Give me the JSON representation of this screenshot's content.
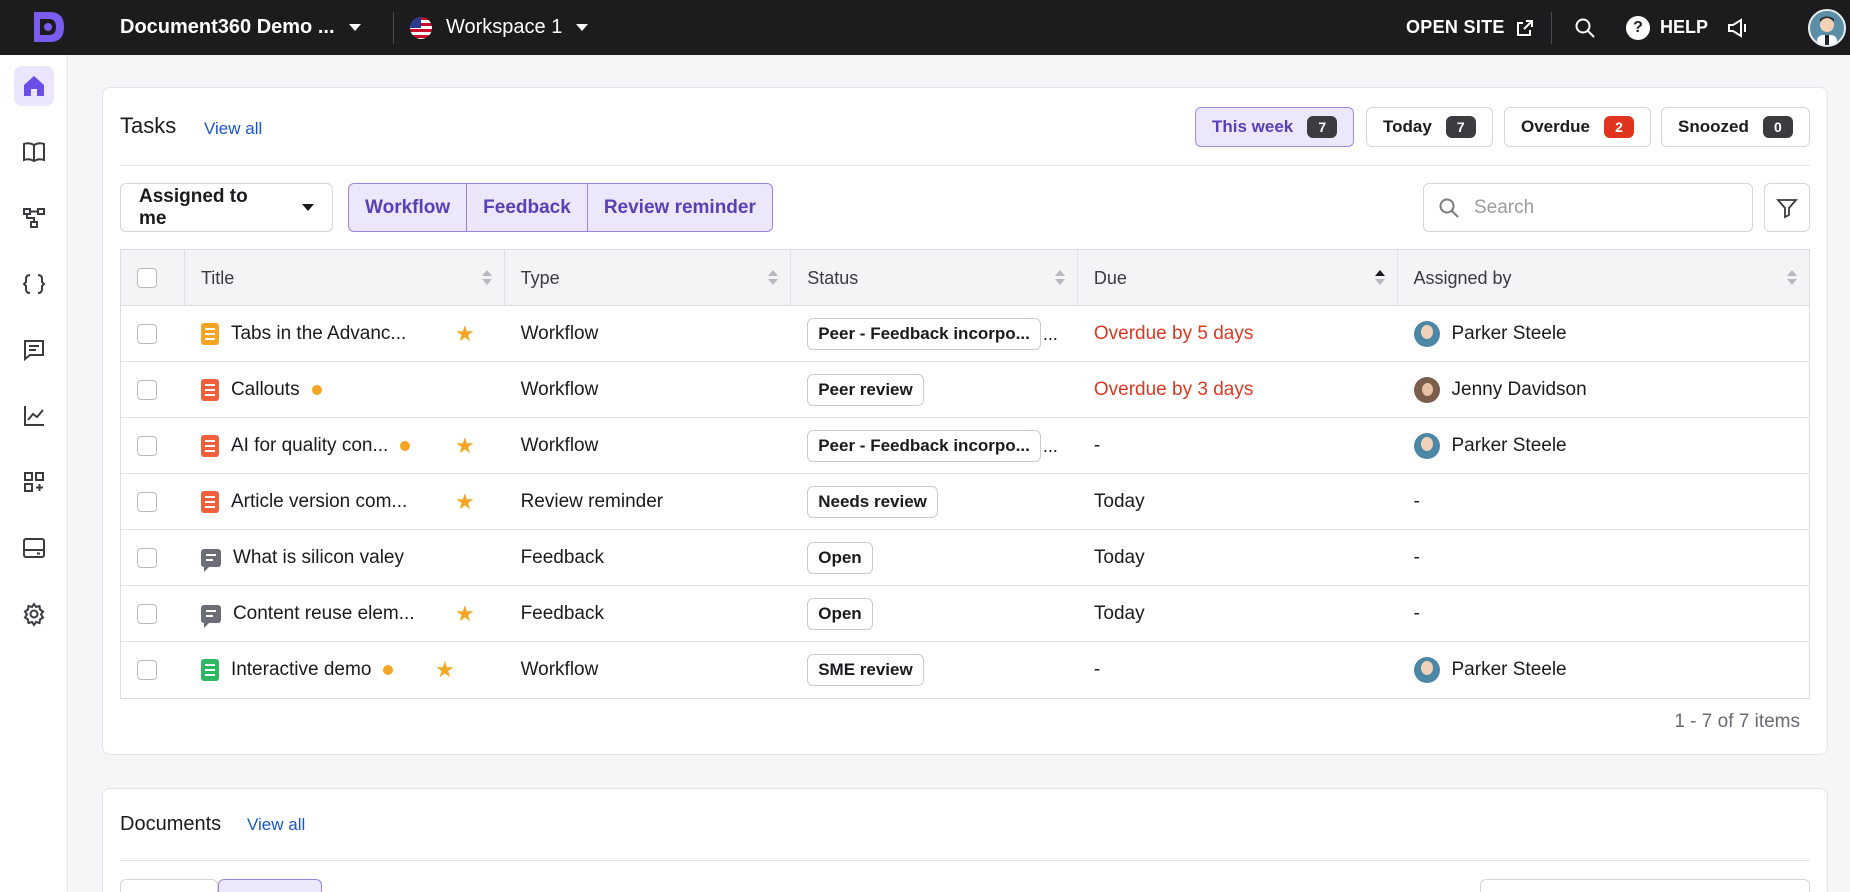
{
  "topbar": {
    "project_name": "Document360 Demo ...",
    "workspace_name": "Workspace 1",
    "open_site_label": "OPEN SITE",
    "help_label": "HELP"
  },
  "sidebar": {
    "items": [
      {
        "icon": "home-icon",
        "active": true
      },
      {
        "icon": "book-icon",
        "active": false
      },
      {
        "icon": "hierarchy-icon",
        "active": false
      },
      {
        "icon": "code-braces-icon",
        "active": false
      },
      {
        "icon": "comment-icon",
        "active": false
      },
      {
        "icon": "analytics-icon",
        "active": false
      },
      {
        "icon": "apps-icon",
        "active": false
      },
      {
        "icon": "widget-icon",
        "active": false
      },
      {
        "icon": "settings-icon",
        "active": false
      }
    ]
  },
  "tasks": {
    "title": "Tasks",
    "view_all": "View all",
    "time_filters": [
      {
        "label": "This week",
        "count": "7",
        "active": true
      },
      {
        "label": "Today",
        "count": "7",
        "active": false
      },
      {
        "label": "Overdue",
        "count": "2",
        "active": false
      },
      {
        "label": "Snoozed",
        "count": "0",
        "active": false
      }
    ],
    "assignment_dropdown": "Assigned to me",
    "type_filters": [
      "Workflow",
      "Feedback",
      "Review reminder"
    ],
    "search_placeholder": "Search",
    "columns": [
      "Title",
      "Type",
      "Status",
      "Due",
      "Assigned by"
    ],
    "rows": [
      {
        "title": "Tabs in the Advanc...",
        "icon_color": "#f5a524",
        "icon": "document-icon",
        "dot": false,
        "star": true,
        "type": "Workflow",
        "status": "Peer - Feedback incorpo...",
        "status_more": "...",
        "due": "Overdue by 5 days",
        "due_overdue": true,
        "assigned_by": "Parker Steele",
        "avatar": "ps"
      },
      {
        "title": "Callouts",
        "icon_color": "#f0603c",
        "icon": "document-icon",
        "dot": true,
        "star": false,
        "type": "Workflow",
        "status": "Peer review",
        "status_more": "",
        "due": "Overdue by 3 days",
        "due_overdue": true,
        "assigned_by": "Jenny Davidson",
        "avatar": "jd"
      },
      {
        "title": "AI for quality con...",
        "icon_color": "#f0603c",
        "icon": "document-icon",
        "dot": true,
        "star": true,
        "type": "Workflow",
        "status": "Peer - Feedback incorpo...",
        "status_more": "...",
        "due": "-",
        "due_overdue": false,
        "assigned_by": "Parker Steele",
        "avatar": "ps"
      },
      {
        "title": "Article version com...",
        "icon_color": "#f0603c",
        "icon": "document-icon",
        "dot": false,
        "star": true,
        "type": "Review reminder",
        "status": "Needs review",
        "status_more": "",
        "due": "Today",
        "due_overdue": false,
        "assigned_by": "-",
        "avatar": ""
      },
      {
        "title": "What is silicon valey",
        "icon_color": "#6d6d78",
        "icon": "feedback-icon",
        "dot": false,
        "star": false,
        "type": "Feedback",
        "status": "Open",
        "status_more": "",
        "due": "Today",
        "due_overdue": false,
        "assigned_by": "-",
        "avatar": ""
      },
      {
        "title": "Content reuse elem...",
        "icon_color": "#6d6d78",
        "icon": "feedback-icon",
        "dot": false,
        "star": true,
        "type": "Feedback",
        "status": "Open",
        "status_more": "",
        "due": "Today",
        "due_overdue": false,
        "assigned_by": "-",
        "avatar": ""
      },
      {
        "title": "Interactive demo",
        "icon_color": "#2fb862",
        "icon": "document-icon",
        "dot": true,
        "star": true,
        "type": "Workflow",
        "status": "SME review",
        "status_more": "",
        "due": "-",
        "due_overdue": false,
        "assigned_by": "Parker Steele",
        "avatar": "ps"
      }
    ],
    "pagination": "1 - 7 of 7 items"
  },
  "documents": {
    "title": "Documents",
    "view_all": "View all"
  },
  "colors": {
    "accent": "#5a3fb5",
    "accent_bg": "#ece7fb",
    "overdue": "#d83a24",
    "link": "#1a56c6",
    "star": "#f5a524"
  }
}
